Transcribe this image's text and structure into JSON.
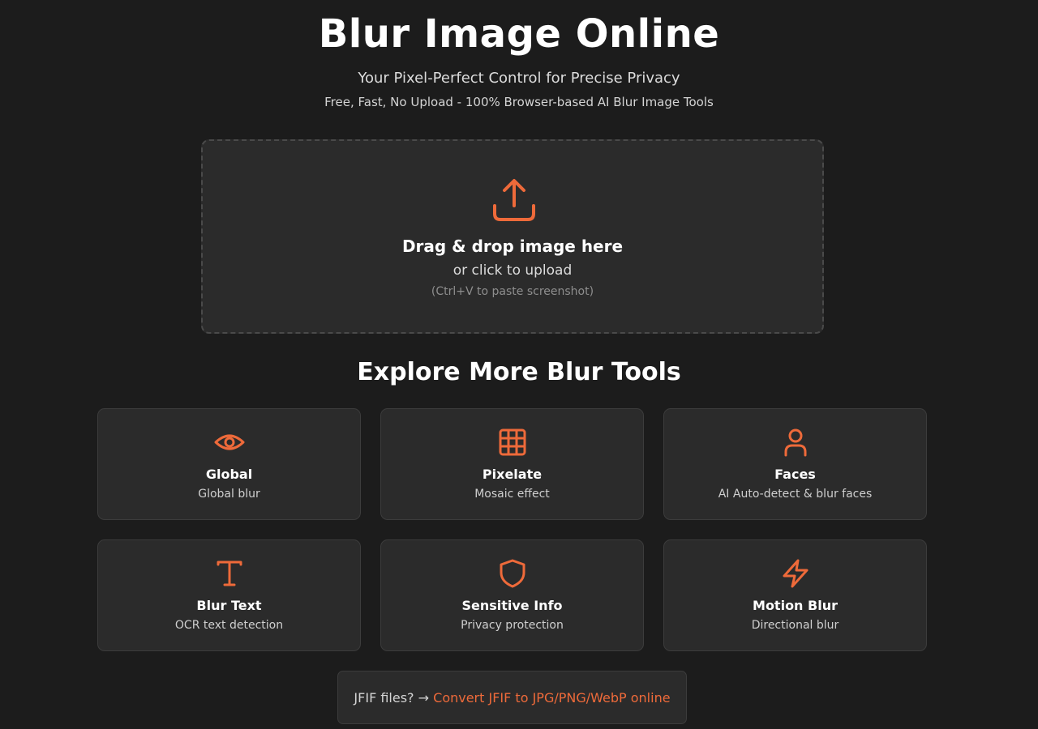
{
  "hero": {
    "title": "Blur Image Online",
    "subtitle": "Your Pixel-Perfect Control for Precise Privacy",
    "tagline": "Free, Fast, No Upload - 100% Browser-based AI Blur Image Tools"
  },
  "dropzone": {
    "icon": "upload-icon",
    "title": "Drag & drop image here",
    "subtitle": "or click to upload",
    "hint": "(Ctrl+V to paste screenshot)"
  },
  "tools_section": {
    "title": "Explore More Blur Tools",
    "items": [
      {
        "icon": "eye-icon",
        "name": "Global",
        "desc": "Global blur"
      },
      {
        "icon": "grid-icon",
        "name": "Pixelate",
        "desc": "Mosaic effect"
      },
      {
        "icon": "user-icon",
        "name": "Faces",
        "desc": "AI Auto-detect & blur faces"
      },
      {
        "icon": "text-icon",
        "name": "Blur Text",
        "desc": "OCR text detection"
      },
      {
        "icon": "shield-icon",
        "name": "Sensitive Info",
        "desc": "Privacy protection"
      },
      {
        "icon": "lightning-icon",
        "name": "Motion Blur",
        "desc": "Directional blur"
      }
    ]
  },
  "jfif": {
    "prefix": "JFIF files? →",
    "link": "Convert JFIF to JPG/PNG/WebP online"
  },
  "colors": {
    "accent": "#ee6a3a",
    "background": "#1c1c1c",
    "card": "#2b2b2b"
  }
}
